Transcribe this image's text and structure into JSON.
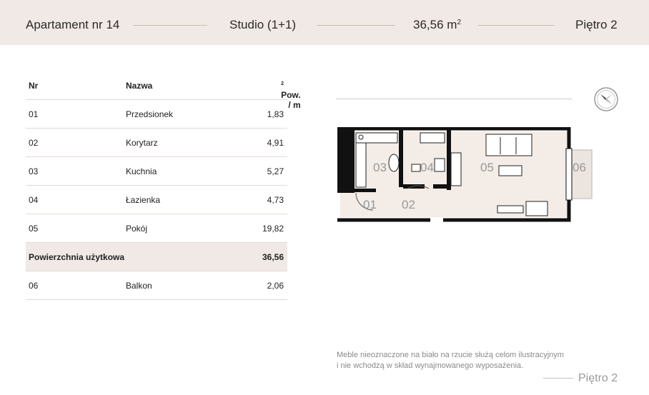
{
  "header": {
    "apartment": "Apartament  nr 14",
    "type": "Studio (1+1)",
    "area_value": "36,56 m",
    "area_sup": "2",
    "floor": "Piętro 2"
  },
  "table": {
    "head": {
      "nr": "Nr",
      "name": "Nazwa",
      "area": "Pow. / m",
      "area_sup": "2"
    },
    "rows": [
      {
        "nr": "01",
        "name": "Przedsionek",
        "area": "1,83"
      },
      {
        "nr": "02",
        "name": "Korytarz",
        "area": "4,91"
      },
      {
        "nr": "03",
        "name": "Kuchnia",
        "area": "5,27"
      },
      {
        "nr": "04",
        "name": "Łazienka",
        "area": "4,73"
      },
      {
        "nr": "05",
        "name": "Pokój",
        "area": "19,82"
      }
    ],
    "total": {
      "label": "Powierzchnia użytkowa",
      "area": "36,56"
    },
    "extra": {
      "nr": "06",
      "name": "Balkon",
      "area": "2,06"
    }
  },
  "plan": {
    "labels": [
      "01",
      "02",
      "03",
      "04",
      "05",
      "06"
    ]
  },
  "note": {
    "line1": "Meble nieoznaczone na biało na rzucie służą celom ilustracyjnym",
    "line2": "i nie wchodzą w skład wynajmowanego wyposażenia."
  },
  "footer": {
    "floor": "Piętro 2"
  },
  "colors": {
    "header_bg": "#f1e9e5",
    "floor_fill": "#f3ece7",
    "wall": "#111111"
  }
}
